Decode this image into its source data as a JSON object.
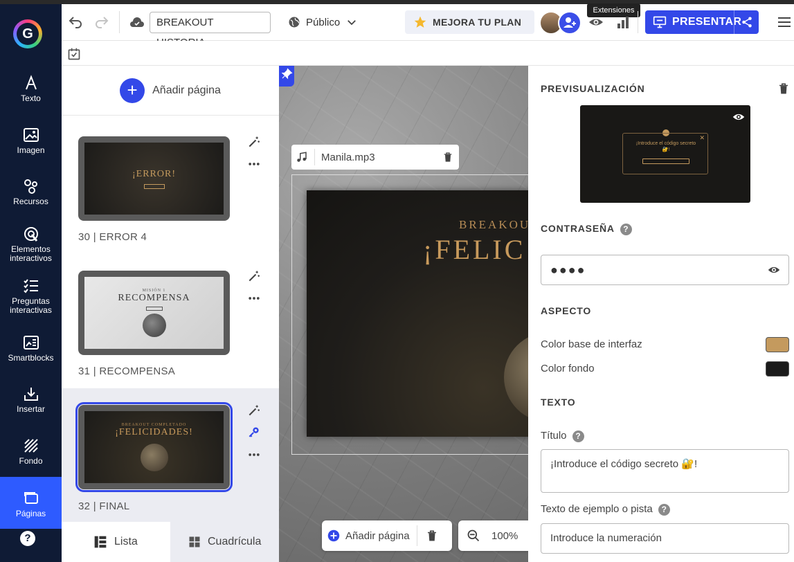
{
  "sidebar": {
    "items": [
      {
        "label": "Texto",
        "icon": "text-icon"
      },
      {
        "label": "Imagen",
        "icon": "image-icon"
      },
      {
        "label": "Recursos",
        "icon": "resources-icon"
      },
      {
        "label": "Elementos interactivos",
        "icon": "interactive-icon"
      },
      {
        "label": "Preguntas interactivas",
        "icon": "questions-icon"
      },
      {
        "label": "Smartblocks",
        "icon": "smartblocks-icon"
      },
      {
        "label": "Insertar",
        "icon": "insert-icon"
      },
      {
        "label": "Fondo",
        "icon": "background-icon"
      },
      {
        "label": "Páginas",
        "icon": "pages-icon"
      }
    ],
    "help": "?"
  },
  "header": {
    "title_value": "BREAKOUT HISTORIA",
    "visibility": "Público",
    "upgrade_label": "MEJORA TU PLAN",
    "tooltip": "Extensiones",
    "present_label": "PRESENTAR"
  },
  "pages_panel": {
    "add_label": "Añadir página",
    "thumbs": [
      {
        "number": "30",
        "name": "ERROR 4",
        "label": "30 |  ERROR 4",
        "slide_main": "¡ERROR!",
        "slide_small": ""
      },
      {
        "number": "31",
        "name": "RECOMPENSA",
        "label": "31 |  RECOMPENSA",
        "slide_main": "RECOMPENSA",
        "slide_small": "MISIÓN 1"
      },
      {
        "number": "32",
        "name": "FINAL",
        "label": "32 |  FINAL",
        "slide_main": "¡FELICIDADES!",
        "slide_small": "BREAKOUT COMPLETADO"
      }
    ],
    "view_list": "Lista",
    "view_grid": "Cuadrícula"
  },
  "canvas": {
    "audio_file": "Manila.mp3",
    "slide_sub": "BREAKOUT",
    "slide_main": "¡FELIC",
    "toolbar_add": "Añadir página",
    "zoom": "100%"
  },
  "properties": {
    "preview_title": "PREVISUALIZACIÓN",
    "preview_dialog_text": "¡Introduce el código secreto 🔐!",
    "password_title": "CONTRASEÑA",
    "password_value": "●●●●",
    "appearance_title": "ASPECTO",
    "base_color_label": "Color base de interfaz",
    "base_color": "#c49a5e",
    "bg_color_label": "Color fondo",
    "bg_color": "#1a1a1a",
    "text_title": "TEXTO",
    "title_label": "Título",
    "title_value": "¡Introduce el código secreto 🔐!",
    "hint_label": "Texto de ejemplo o pista",
    "hint_value": "Introduce la numeración"
  },
  "colors": {
    "rail": "#0f1b35",
    "accent": "#3348e8"
  }
}
